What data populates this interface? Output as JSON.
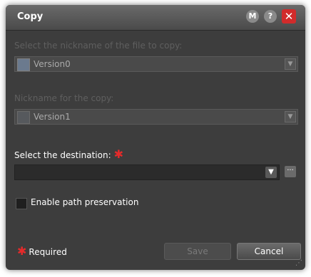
{
  "window": {
    "title": "Copy",
    "buttons": {
      "m_label": "M",
      "help_label": "?",
      "close_label": "✕"
    }
  },
  "fields": {
    "source": {
      "label": "Select the nickname of the file to copy:",
      "value": "Version0"
    },
    "copy_nickname": {
      "label": "Nickname for the copy:",
      "value": "Version1"
    },
    "destination": {
      "label": "Select the destination:",
      "value": "",
      "browse_label": "···"
    },
    "path_preservation": {
      "label": "Enable path preservation",
      "checked": false
    }
  },
  "footer": {
    "required_marker": "✱",
    "required_label": "Required",
    "save_label": "Save",
    "cancel_label": "Cancel"
  },
  "icons": {
    "dropdown": "chevron-down-icon",
    "file_thumb": "film-frame-icon",
    "required_star": "asterisk-icon",
    "resize": "resize-grip-icon"
  },
  "colors": {
    "dialog_bg": "#3d3d3d",
    "title_bar": "#5a5a5a",
    "close_button": "#d12b2b",
    "required_star": "#e52a2a",
    "disabled_text": "#5f5f5f"
  }
}
